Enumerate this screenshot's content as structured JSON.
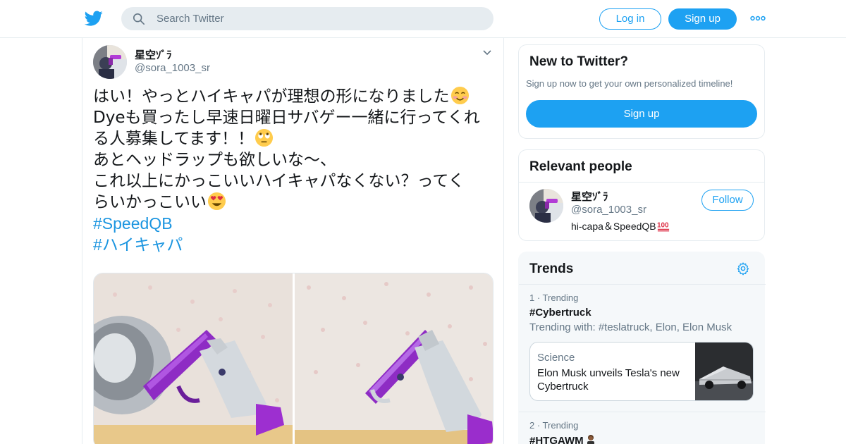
{
  "header": {
    "search_placeholder": "Search Twitter",
    "login_label": "Log in",
    "signup_label": "Sign up"
  },
  "tweet": {
    "display_name": "星空ｿﾞﾗ",
    "handle": "@sora_1003_sr",
    "lines": [
      "はい！やっとハイキャパが理想の形になりました",
      "Dyeも買ったし早速日曜日サバゲー一緒に行ってくれ",
      "る人募集してます！！",
      "あとヘッドラップも欲しいな〜、",
      "これ以上にかっこいいハイキャパなくない？ってく",
      "らいかっこいい"
    ],
    "hashtags": [
      "#SpeedQB",
      "#ハイキャパ"
    ]
  },
  "sidebar": {
    "new_title": "New to Twitter?",
    "new_subtitle": "Sign up now to get your own personalized timeline!",
    "new_signup_label": "Sign up",
    "people_title": "Relevant people",
    "person": {
      "name": "星空ｿﾞﾗ",
      "handle": "@sora_1003_sr",
      "bio": "hi-capa＆SpeedQB",
      "follow_label": "Follow"
    },
    "trends_title": "Trends",
    "trends": [
      {
        "rank_label": "1 · Trending",
        "name": "#Cybertruck",
        "trending_with": "Trending with: #teslatruck, Elon, Elon Musk",
        "news_category": "Science",
        "news_title": "Elon Musk unveils Tesla's new Cybertruck"
      },
      {
        "rank_label": "2 · Trending",
        "name": "#HTGAWM"
      }
    ]
  },
  "colors": {
    "brand_blue": "#1da1f2",
    "hashtag_blue": "#1b95e0",
    "muted_text": "#657786",
    "border": "#e6ecf0"
  },
  "icons": [
    "twitter-logo-icon",
    "search-icon",
    "more-icon",
    "chevron-down-icon",
    "gear-icon"
  ]
}
